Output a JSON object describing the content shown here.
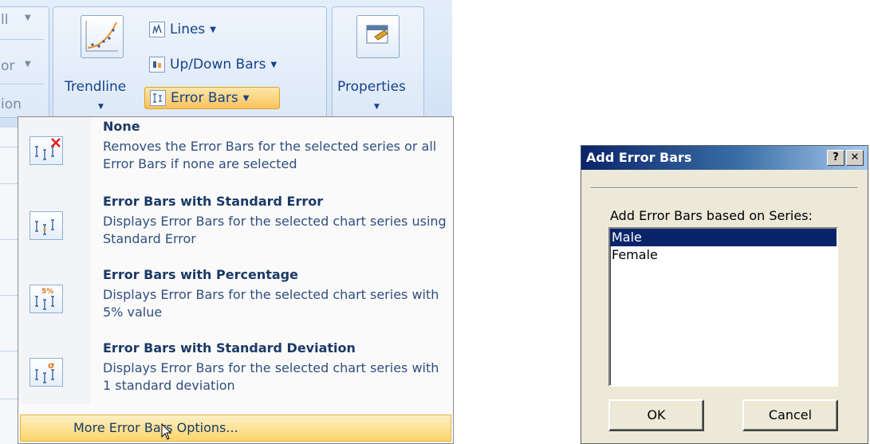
{
  "ribbon": {
    "cutoff_labels": [
      "ll",
      "or",
      "ion"
    ],
    "trendline_label": "Trendline",
    "lines_label": "Lines",
    "updown_label": "Up/Down Bars",
    "errorbars_label": "Error Bars",
    "properties_label": "Properties"
  },
  "menu": {
    "items": [
      {
        "title": "None",
        "description": "Removes the Error Bars for the selected series or all Error Bars if none are selected",
        "icon": "error-bars-none-icon"
      },
      {
        "title": "Error Bars with Standard Error",
        "description": "Displays Error Bars for the selected chart series using Standard Error",
        "icon": "error-bars-standard-error-icon"
      },
      {
        "title": "Error Bars with Percentage",
        "description": "Displays Error Bars for the selected chart series with 5% value",
        "icon": "error-bars-percentage-icon",
        "badge": "5%"
      },
      {
        "title": "Error Bars with Standard Deviation",
        "description": "Displays Error Bars for the selected chart series with 1 standard deviation",
        "icon": "error-bars-standard-deviation-icon",
        "badge": "σ"
      }
    ],
    "footer": "More Error Bars Options..."
  },
  "dialog": {
    "title": "Add Error Bars",
    "help_label": "?",
    "close_label": "✕",
    "prompt": "Add Error Bars based on Series:",
    "series": [
      "Male",
      "Female"
    ],
    "selected": "Male",
    "ok_label": "OK",
    "cancel_label": "Cancel"
  },
  "colors": {
    "highlight": "#fbc25a",
    "selection": "#0a246a",
    "title_bar": "#0a246a"
  }
}
